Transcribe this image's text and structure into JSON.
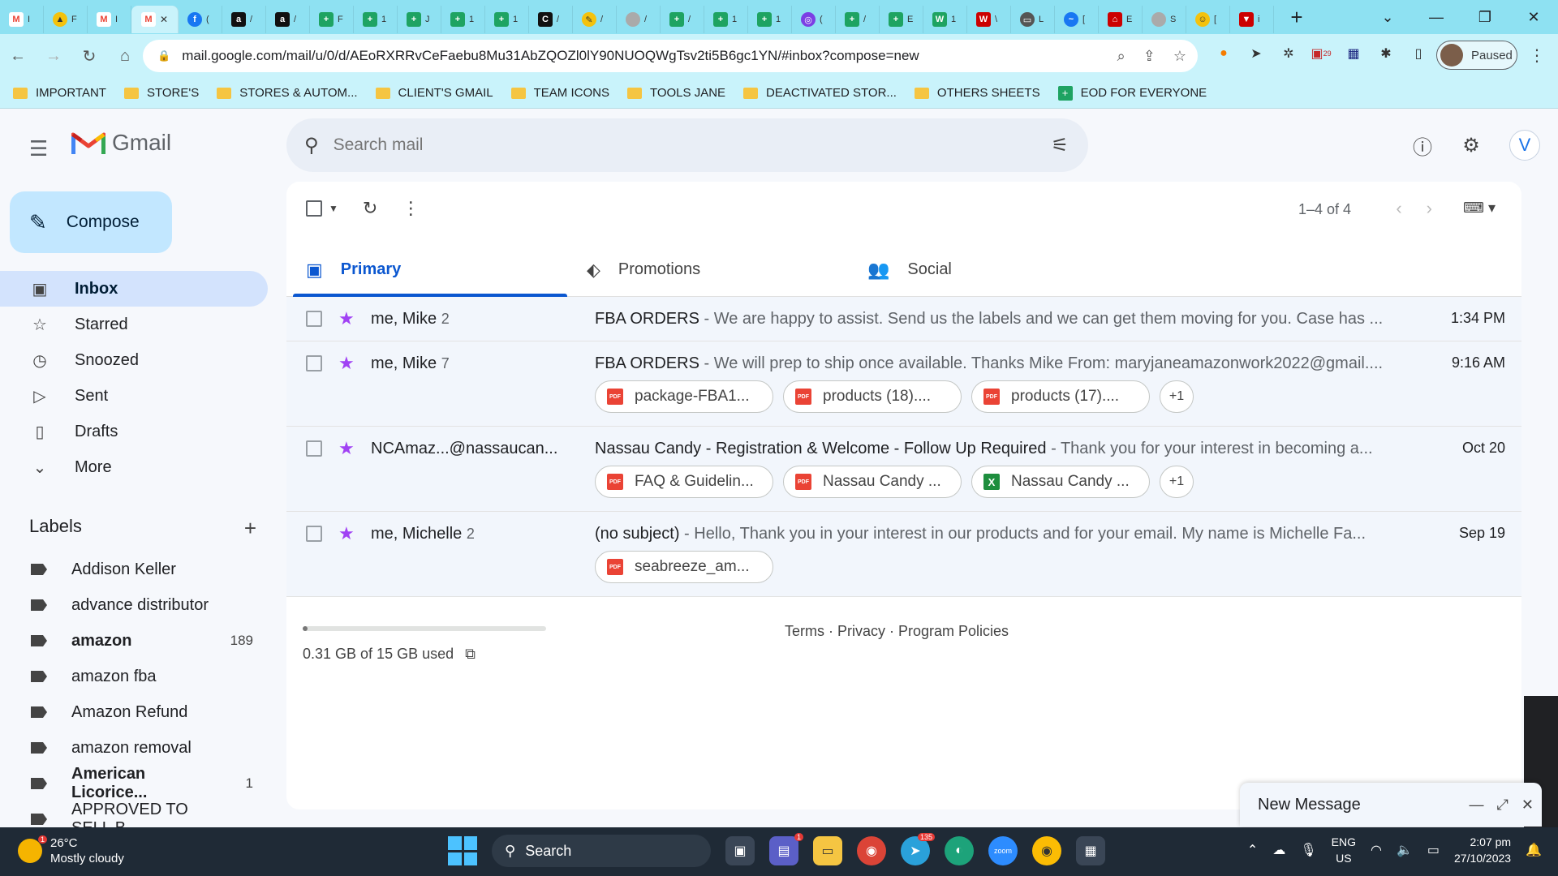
{
  "browser": {
    "url": "mail.google.com/mail/u/0/d/AEoRXRRvCeFaebu8Mu31AbZQOZl0lY90NUOQWgTsv2ti5B6gc1YN/#inbox?compose=new",
    "profile_status": "Paused",
    "bookmarks": [
      "IMPORTANT",
      "STORE'S",
      "STORES & AUTOM...",
      "CLIENT'S GMAIL",
      "TEAM ICONS",
      "TOOLS JANE",
      "DEACTIVATED STOR...",
      "OTHERS SHEETS",
      "EOD FOR EVERYONE"
    ],
    "extension_badge": "29"
  },
  "gmail": {
    "app_name": "Gmail",
    "search_placeholder": "Search mail",
    "avatar_letter": "V",
    "compose_label": "Compose",
    "nav": [
      "Inbox",
      "Starred",
      "Snoozed",
      "Sent",
      "Drafts",
      "More"
    ],
    "labels_title": "Labels",
    "labels": [
      {
        "name": "Addison Keller",
        "count": ""
      },
      {
        "name": "advance distributor",
        "count": ""
      },
      {
        "name": "amazon",
        "count": "189"
      },
      {
        "name": "amazon fba",
        "count": ""
      },
      {
        "name": "Amazon Refund",
        "count": ""
      },
      {
        "name": "amazon removal",
        "count": ""
      },
      {
        "name": "American Licorice...",
        "count": "1"
      },
      {
        "name": "APPROVED TO SELL B...",
        "count": ""
      }
    ],
    "pager": "1–4 of 4",
    "tabs": [
      "Primary",
      "Promotions",
      "Social"
    ],
    "emails": [
      {
        "from": "me, Mike",
        "thread": "2",
        "subject": "FBA ORDERS",
        "snippet": " - We are happy to assist. Send us the labels and we can get them moving for you. Case has ...",
        "date": "1:34 PM",
        "attachments": []
      },
      {
        "from": "me, Mike",
        "thread": "7",
        "subject": "FBA ORDERS",
        "snippet": " - We will prep to ship once available. Thanks Mike From: maryjaneamazonwork2022@gmail....",
        "date": "9:16 AM",
        "attachments": [
          "package-FBA1...",
          "products (18)....",
          "products (17)...."
        ],
        "more": "+1"
      },
      {
        "from": "NCAmaz...@nassaucan...",
        "thread": "",
        "subject": "Nassau Candy - Registration & Welcome - Follow Up Required",
        "snippet": " - Thank you for your interest in becoming a...",
        "date": "Oct 20",
        "attachments": [
          "FAQ & Guidelin...",
          "Nassau Candy ...",
          "Nassau Candy ..."
        ],
        "more": "+1"
      },
      {
        "from": "me, Michelle",
        "thread": "2",
        "subject": "(no subject)",
        "snippet": " - Hello, Thank you in your interest in our products and for your email. My name is Michelle Fa...",
        "date": "Sep 19",
        "attachments": [
          "seabreeze_am..."
        ]
      }
    ],
    "storage_text": "0.31 GB of 15 GB used",
    "storage_fraction": 0.02,
    "footer_links": "Terms · Privacy · Program Policies",
    "new_message": "New Message"
  },
  "taskbar": {
    "weather_temp": "26°C",
    "weather_desc": "Mostly cloudy",
    "weather_badge": "1",
    "search": "Search",
    "teams_badge": "1",
    "telegram_badge": "135",
    "lang": "ENG",
    "region": "US",
    "time": "2:07 pm",
    "date": "27/10/2023"
  },
  "colors": {
    "accent": "#0b57d0",
    "compose_bg": "#c2e7ff",
    "chrome_tabstrip": "#8ee1f2",
    "star": "#a142f4"
  }
}
